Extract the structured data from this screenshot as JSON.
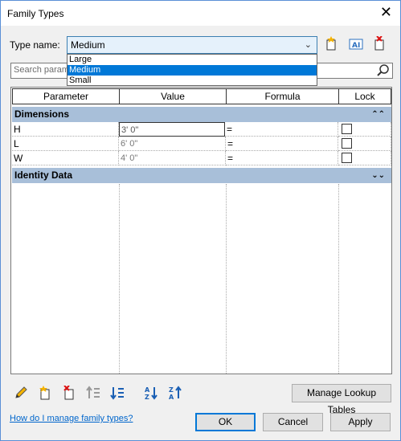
{
  "window": {
    "title": "Family Types",
    "close_glyph": "✕"
  },
  "type_name": {
    "label": "Type name:",
    "selected": "Medium",
    "options": [
      "Large",
      "Medium",
      "Small"
    ]
  },
  "search": {
    "placeholder": "Search param"
  },
  "table": {
    "columns": [
      "Parameter",
      "Value",
      "Formula",
      "Lock"
    ],
    "groups": [
      {
        "name": "Dimensions",
        "rows": [
          {
            "param": "H",
            "value": "3'  0\"",
            "formula": "=",
            "locked": false
          },
          {
            "param": "L",
            "value": "6'  0\"",
            "formula": "=",
            "locked": false
          },
          {
            "param": "W",
            "value": "4'  0\"",
            "formula": "=",
            "locked": false
          }
        ]
      },
      {
        "name": "Identity Data",
        "rows": []
      }
    ]
  },
  "toolbar": {
    "manage_lookup_label": "Manage Lookup Tables"
  },
  "footer": {
    "help_link": "How do I manage family types?",
    "ok_label": "OK",
    "cancel_label": "Cancel",
    "apply_label": "Apply"
  },
  "icons": {
    "new_type": "new-type-icon",
    "rename_type": "rename-type-icon",
    "delete_type": "delete-type-icon",
    "edit_param": "pencil-icon",
    "new_param": "new-parameter-icon",
    "delete_param": "delete-parameter-icon",
    "move_up": "move-up-icon",
    "move_down": "move-down-icon",
    "sort_asc": "sort-ascending-icon",
    "sort_desc": "sort-descending-icon",
    "search": "search-icon"
  },
  "colors": {
    "accent": "#0078d7",
    "group_header": "#a8bfd9",
    "link": "#0066cc"
  }
}
